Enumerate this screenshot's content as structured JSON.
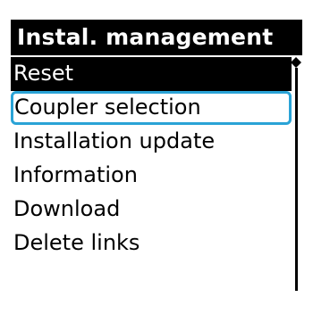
{
  "header": {
    "title": "Instal. management"
  },
  "menu": {
    "items": [
      {
        "label": "Reset",
        "selected": true
      },
      {
        "label": "Coupler selection",
        "focused": true
      },
      {
        "label": "Installation update"
      },
      {
        "label": "Information"
      },
      {
        "label": "Download"
      },
      {
        "label": "Delete links"
      }
    ]
  },
  "scrollbar": {
    "thumb_icon": "diamond-icon",
    "position": 0
  },
  "colors": {
    "background": "#ffffff",
    "foreground": "#000000",
    "selection_background": "#000000",
    "selection_text": "#ffffff",
    "focus_outline": "#2aa3d6"
  }
}
